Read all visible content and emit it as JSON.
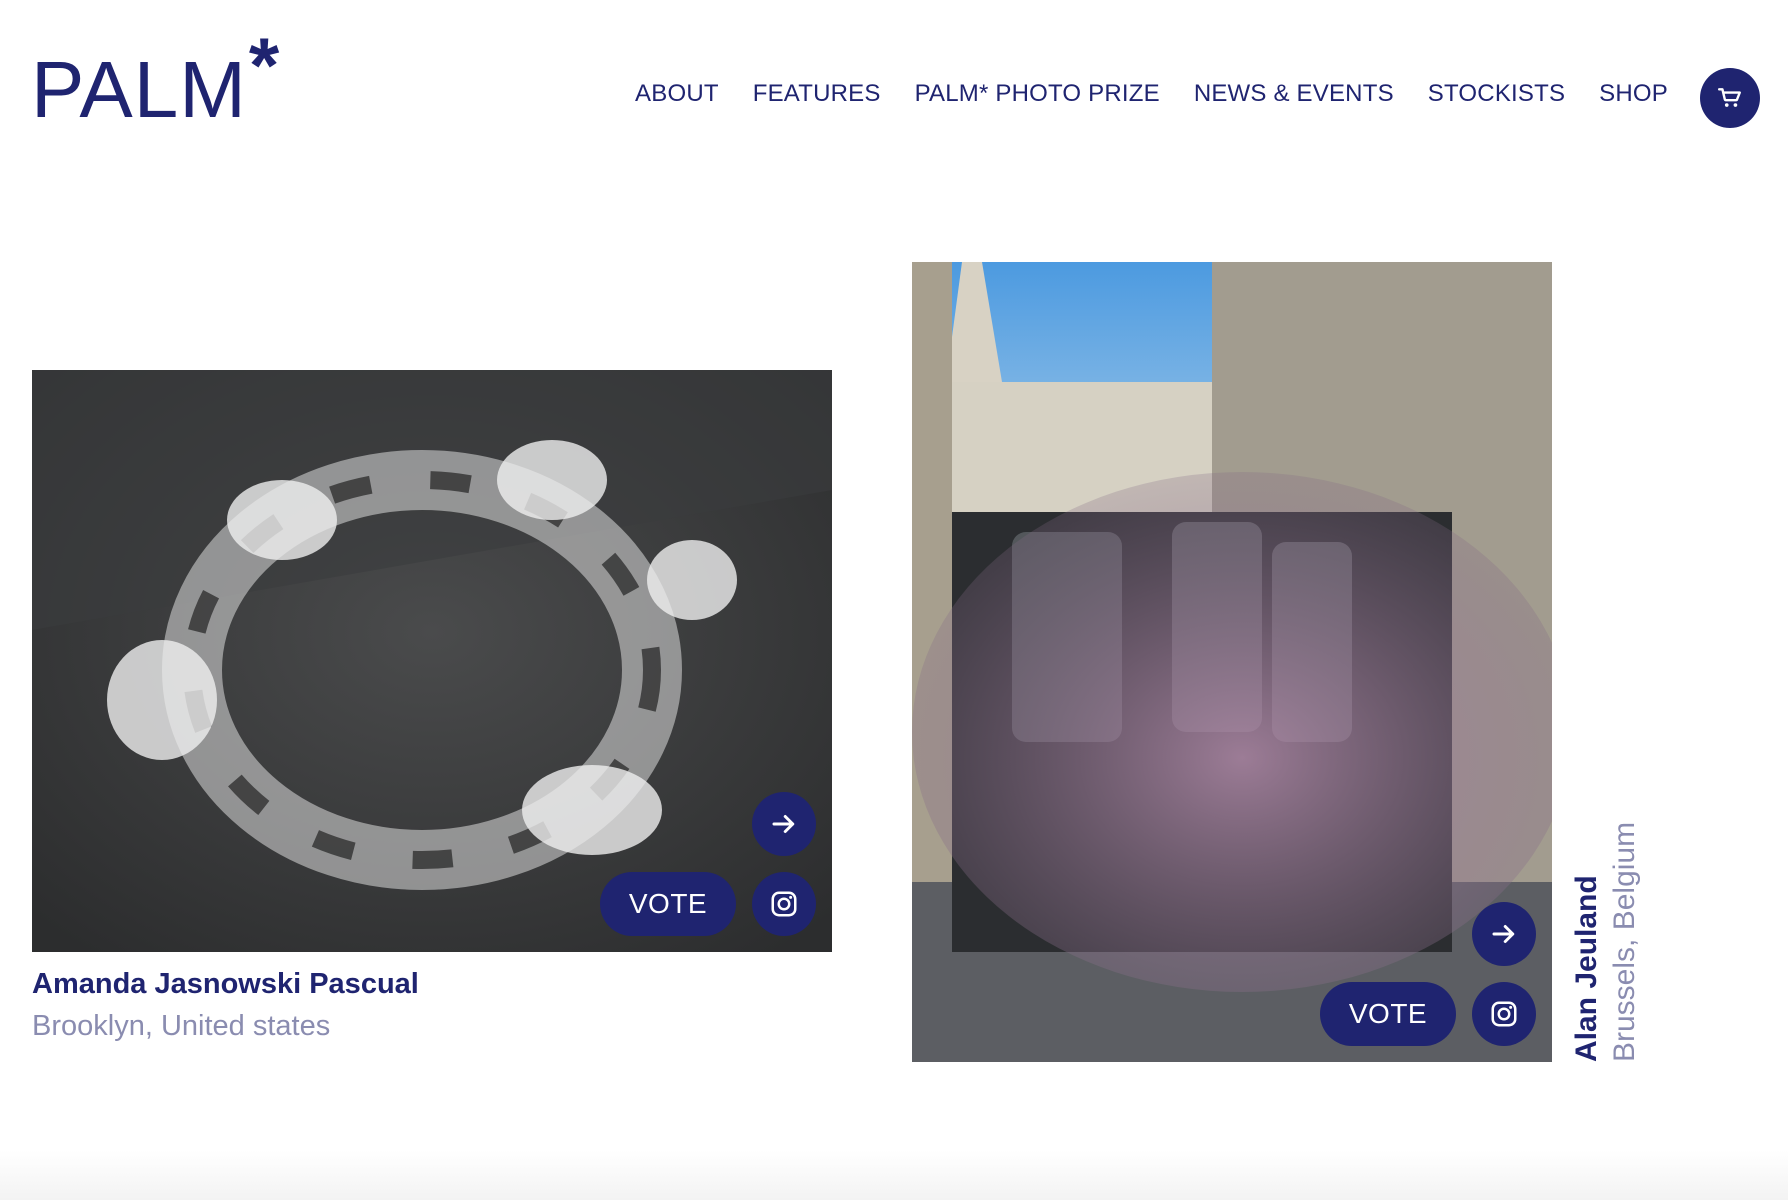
{
  "brand": {
    "logo_text": "PALM",
    "logo_mark": "*"
  },
  "nav": {
    "items": [
      {
        "label": "ABOUT"
      },
      {
        "label": "FEATURES"
      },
      {
        "label": "PALM* PHOTO PRIZE"
      },
      {
        "label": "NEWS & EVENTS"
      },
      {
        "label": "STOCKISTS"
      },
      {
        "label": "SHOP"
      }
    ],
    "cart_icon": "cart-icon"
  },
  "entries": [
    {
      "photographer": "Amanda Jasnowski Pascual",
      "location": "Brooklyn, United states",
      "vote_label": "VOTE",
      "icons": [
        "arrow-right-icon",
        "instagram-icon"
      ]
    },
    {
      "photographer": "Alan Jeuland",
      "location": "Brussels, Belgium",
      "vote_label": "VOTE",
      "icons": [
        "arrow-right-icon",
        "instagram-icon"
      ]
    }
  ],
  "colors": {
    "accent": "#1f2470",
    "muted": "#8a8cb0"
  }
}
